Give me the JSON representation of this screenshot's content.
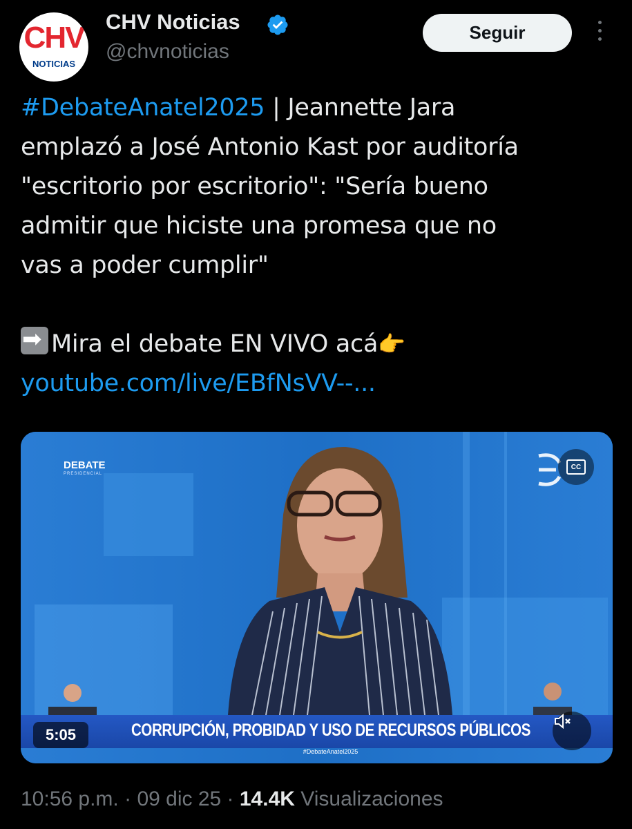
{
  "account": {
    "name": "CHV Noticias",
    "handle": "@chvnoticias",
    "avatar_letters": "CHV",
    "avatar_sub": "NOTICIAS",
    "verified": true,
    "verified_color": "#1d9bf0"
  },
  "actions": {
    "follow_label": "Seguir",
    "more_icon": "more-vertical-icon"
  },
  "tweet": {
    "hashtag": "#DebateAnatel2025",
    "line1_rest": " | Jeannette Jara",
    "line2": "emplazó a José Antonio Kast por auditoría",
    "line3": "\"escritorio por escritorio\": \"Sería bueno",
    "line4": "admitir que hiciste una promesa que no",
    "line5": "vas a poder cumplir\"",
    "cta": "Mira el debate EN VIVO acá",
    "link": "youtube.com/live/EBfNsVV--..."
  },
  "video": {
    "logo_title": "DEBATE",
    "logo_sub": "PRESIDENCIAL",
    "chyron": "CORRUPCIÓN, PROBIDAD Y USO DE RECURSOS PÚBLICOS",
    "chyron_tag": "#DebateAnatel2025",
    "duration": "5:05",
    "cc_label": "CC"
  },
  "meta": {
    "time": "10:56 p.m.",
    "sep1": " · ",
    "date": "09 dic 25",
    "sep2": " · ",
    "views": "14.4K",
    "views_label": " Visualizaciones"
  },
  "colors": {
    "link": "#1d9bf0",
    "background": "#000000",
    "muted": "#71767b"
  }
}
